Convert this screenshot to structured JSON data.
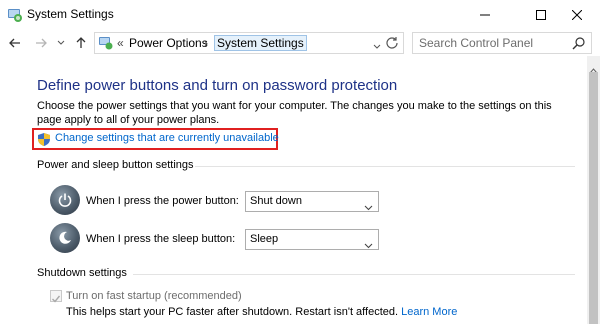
{
  "window": {
    "title": "System Settings"
  },
  "address_bar": {
    "overflow": "«",
    "crumbs": [
      "Power Options",
      "System Settings"
    ],
    "separator": "›"
  },
  "search": {
    "placeholder": "Search Control Panel"
  },
  "main": {
    "heading": "Define power buttons and turn on password protection",
    "description": "Choose the power settings that you want for your computer. The changes you make to the settings on this page apply to all of your power plans.",
    "change_settings_link": "Change settings that are currently unavailable",
    "power_sleep_section": {
      "title": "Power and sleep button settings",
      "rows": [
        {
          "label": "When I press the power button:",
          "value": "Shut down",
          "icon": "power-icon"
        },
        {
          "label": "When I press the sleep button:",
          "value": "Sleep",
          "icon": "sleep-icon"
        }
      ]
    },
    "shutdown_section": {
      "title": "Shutdown settings",
      "fast_startup": {
        "label": "Turn on fast startup (recommended)",
        "checked": true,
        "help_text": "This helps start your PC faster after shutdown. Restart isn't affected.",
        "learn_more": "Learn More"
      }
    }
  },
  "colors": {
    "heading": "#1e3287",
    "link": "#0066cc",
    "highlight_box": "#e02020"
  }
}
